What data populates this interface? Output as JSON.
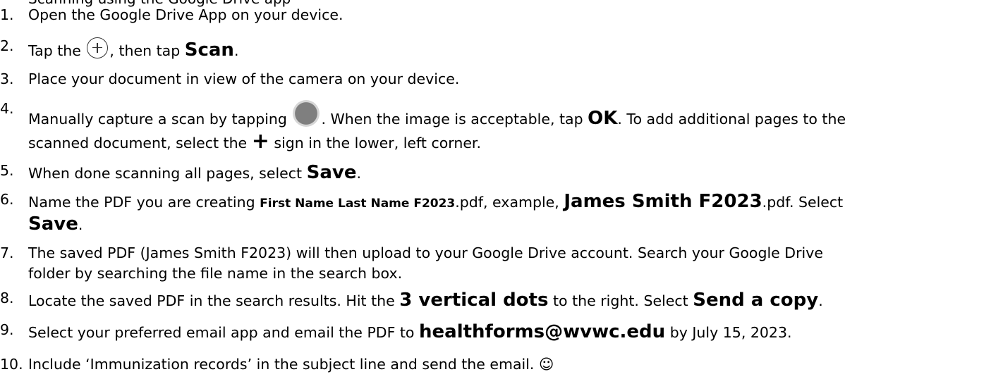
{
  "header_partial": "Scanning using the Google Drive app",
  "steps": [
    {
      "num": "1.",
      "text": "Open the Google Drive App on your device."
    },
    {
      "num": "2.",
      "pre": "Tap the",
      "icon": "plus-circle-icon",
      "mid": ", then tap",
      "bold": "Scan",
      "post": "."
    },
    {
      "num": "3.",
      "text": "Place your document in view of the camera on your device."
    },
    {
      "num": "4.",
      "pre": "Manually capture a scan by tapping",
      "icon": "capture-button-icon",
      "mid": ".  When the image is acceptable, tap",
      "bold": "OK",
      "post": ". To add additional pages to the",
      "line2_pre": "scanned document, select the",
      "line2_bold": "+",
      "line2_post": "sign in the lower, left corner."
    },
    {
      "num": "5.",
      "pre": "When done scanning all pages, select",
      "bold": "Save",
      "post": "."
    },
    {
      "num": "6.",
      "pre": "Name the PDF you are creating",
      "small_bold": "First Name Last Name F2023",
      "mid": ".pdf, example,",
      "bold": "James Smith F2023",
      "post": ".pdf.  Select",
      "line2_bold": "Save",
      "line2_post": "."
    },
    {
      "num": "7.",
      "text": "The saved PDF (James Smith F2023) will then upload to your Google Drive account.  Search your Google Drive",
      "line2": "folder by searching the file name in the search box."
    },
    {
      "num": "8.",
      "pre": "Locate the saved PDF in the search results.  Hit the",
      "bold": "3 vertical dots",
      "mid": "to the right. Select",
      "bold2": "Send a copy",
      "post": "."
    },
    {
      "num": "9.",
      "pre": "Select your preferred email app and email the PDF to",
      "bold": "healthforms@wvwc.edu",
      "post": "by July 15, 2023."
    },
    {
      "num": "10.",
      "text": "Include ‘Immunization records’ in the subject line and send the email. ☺"
    }
  ]
}
